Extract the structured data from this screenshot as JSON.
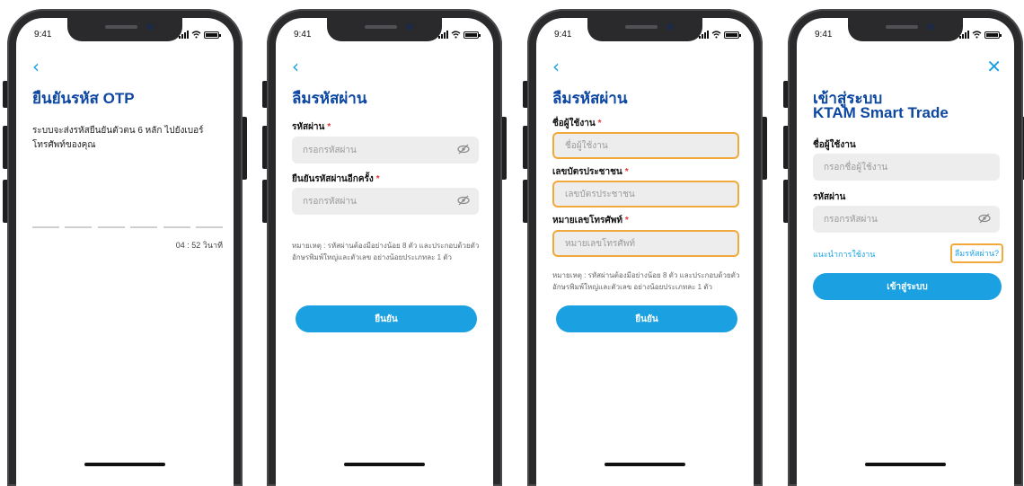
{
  "colors": {
    "accent": "#1ba1e2",
    "title": "#0d47a1",
    "required": "#e53935",
    "highlight": "#f2a93b"
  },
  "status": {
    "time": "9:41"
  },
  "screen1": {
    "title": "ยืนยันรหัส OTP",
    "description": "ระบบจะส่งรหัสยืนยันตัวตน 6 หลัก ไปยังเบอร์โทรศัพท์ของคุณ",
    "timer": "04 : 52  วินาที"
  },
  "screen2": {
    "title": "ลืมรหัสผ่าน",
    "password_label": "รหัสผ่าน",
    "password_placeholder": "กรอกรหัสผ่าน",
    "confirm_label": "ยืนยันรหัสผ่านอีกครั้ง",
    "confirm_placeholder": "กรอกรหัสผ่าน",
    "note": "หมายเหตุ : รหัสผ่านต้องมีอย่างน้อย 8 ตัว และประกอบด้วยตัวอักษรพิมพ์ใหญ่และตัวเลข อย่างน้อยประเภทละ 1 ตัว",
    "submit": "ยืนยัน"
  },
  "screen3": {
    "title": "ลืมรหัสผ่าน",
    "username_label": "ชื่อผู้ใช้งาน",
    "username_placeholder": "ชื่อผู้ใช้งาน",
    "idcard_label": "เลขบัตรประชาชน",
    "idcard_placeholder": "เลขบัตรประชาชน",
    "phone_label": "หมายเลขโทรศัพท์",
    "phone_placeholder": "หมายเลขโทรศัพท์",
    "note": "หมายเหตุ : รหัสผ่านต้องมีอย่างน้อย 8 ตัว และประกอบด้วยตัวอักษรพิมพ์ใหญ่และตัวเลข อย่างน้อยประเภทละ 1 ตัว",
    "submit": "ยืนยัน"
  },
  "screen4": {
    "title_line1": "เข้าสู่ระบบ",
    "title_line2": "KTAM Smart Trade",
    "username_label": "ชื่อผู้ใช้งาน",
    "username_placeholder": "กรอกชื่อผู้ใช้งาน",
    "password_label": "รหัสผ่าน",
    "password_placeholder": "กรอกรหัสผ่าน",
    "guide_link": "แนะนำการใช้งาน",
    "forgot_link": "ลืมรหัสผ่าน?",
    "submit": "เข้าสู่ระบบ"
  }
}
